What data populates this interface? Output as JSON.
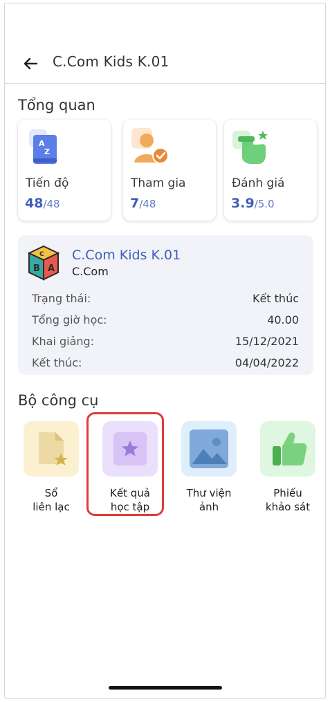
{
  "header": {
    "title": "C.Com Kids K.01"
  },
  "overview": {
    "title": "Tổng quan",
    "cards": [
      {
        "label": "Tiến độ",
        "value": "48",
        "total": "/48",
        "icon": "az-book-icon"
      },
      {
        "label": "Tham gia",
        "value": "7",
        "total": "/48",
        "icon": "user-check-icon"
      },
      {
        "label": "Đánh giá",
        "value": "3.9",
        "total": "/5.0",
        "icon": "hand-star-icon"
      }
    ]
  },
  "course": {
    "name": "C.Com Kids K.01",
    "company": "C.Com",
    "rows": [
      {
        "label": "Trạng thái:",
        "value": "Kết thúc"
      },
      {
        "label": "Tổng giờ học:",
        "value": "40.00"
      },
      {
        "label": "Khai giảng:",
        "value": "15/12/2021"
      },
      {
        "label": "Kết thúc:",
        "value": "04/04/2022"
      }
    ]
  },
  "tools": {
    "title": "Bộ công cụ",
    "items": [
      {
        "line1": "Sổ",
        "line2": "liên lạc",
        "icon": "document-star-icon",
        "color": "#fbf0cf"
      },
      {
        "line1": "Kết quả",
        "line2": "học tập",
        "icon": "star-badge-icon",
        "color": "#ebe0fb"
      },
      {
        "line1": "Thư viện",
        "line2": "ảnh",
        "icon": "image-icon",
        "color": "#dfeefb"
      },
      {
        "line1": "Phiếu",
        "line2": "khảo sát",
        "icon": "thumbs-up-icon",
        "color": "#dff6e0"
      }
    ]
  },
  "colors": {
    "accent": "#3e5fb8",
    "highlight": "#e23a3a"
  }
}
